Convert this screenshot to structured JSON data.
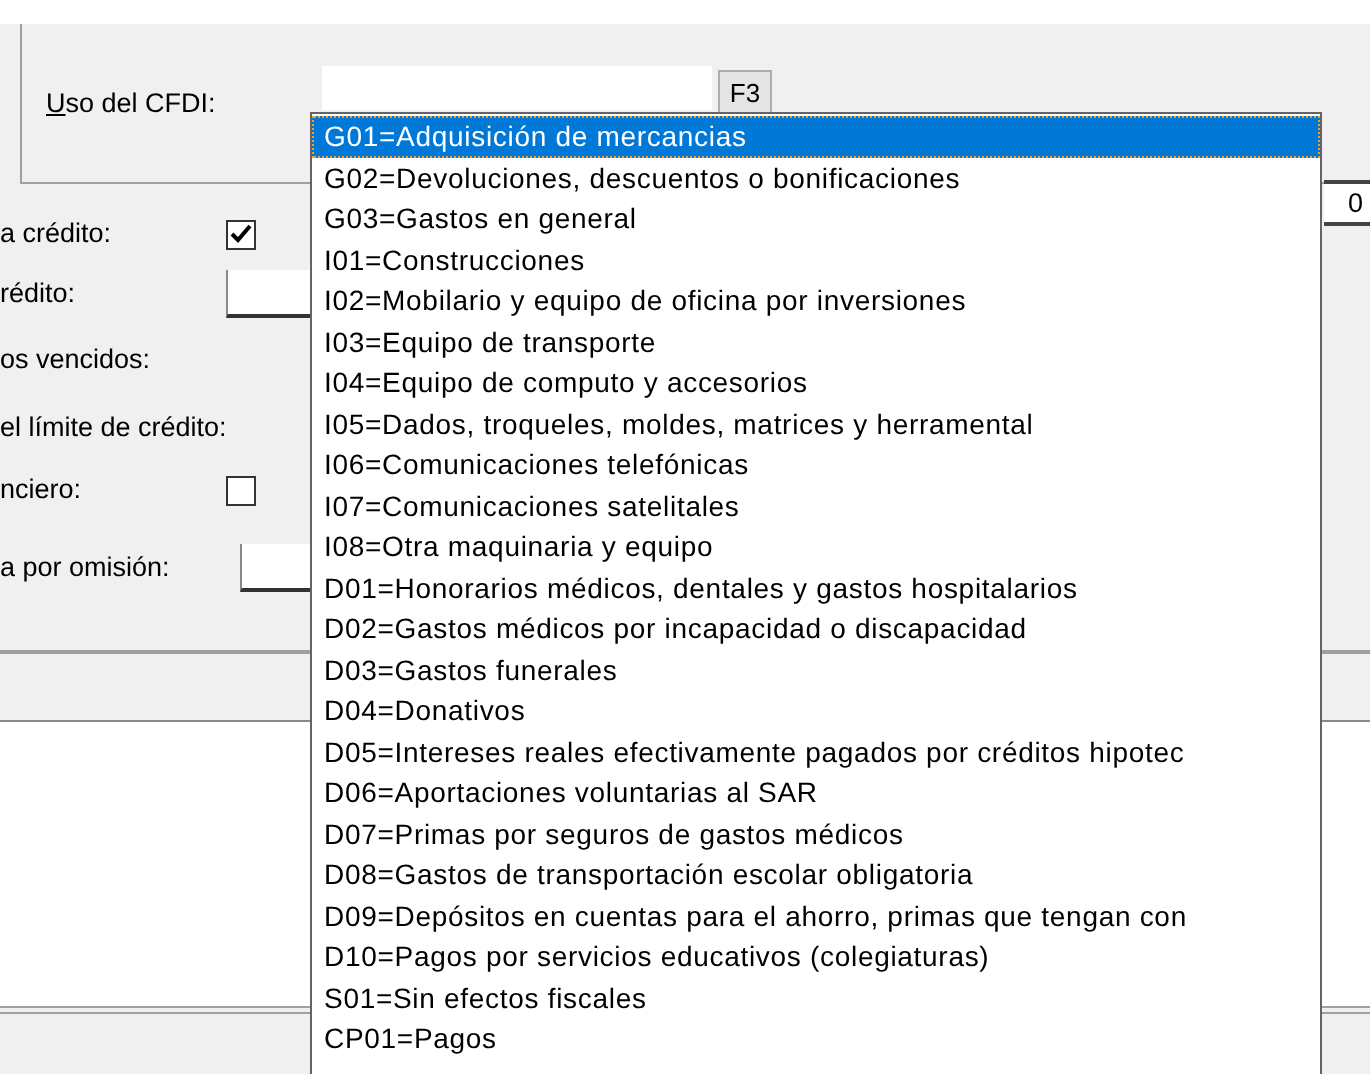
{
  "uso_cfdi": {
    "label": "Uso del CFDI:",
    "button": "F3"
  },
  "form_rows": [
    {
      "kind": "checkbox",
      "label": "a crédito:",
      "checked": true
    },
    {
      "kind": "field",
      "label": "rédito:"
    },
    {
      "kind": "text",
      "label": "os vencidos:"
    },
    {
      "kind": "text",
      "label": "el límite de crédito:"
    },
    {
      "kind": "checkbox",
      "label": "nciero:",
      "checked": false
    },
    {
      "kind": "field",
      "label": "a por omisión:"
    }
  ],
  "right_field": {
    "value": "0"
  },
  "dropdown": {
    "items": [
      {
        "label": "G01=Adquisición de mercancias",
        "selected": true
      },
      {
        "label": "G02=Devoluciones, descuentos o bonificaciones",
        "selected": false
      },
      {
        "label": "G03=Gastos en general",
        "selected": false
      },
      {
        "label": "I01=Construcciones",
        "selected": false
      },
      {
        "label": "I02=Mobilario y equipo de oficina por inversiones",
        "selected": false
      },
      {
        "label": "I03=Equipo de transporte",
        "selected": false
      },
      {
        "label": "I04=Equipo de computo y accesorios",
        "selected": false
      },
      {
        "label": "I05=Dados, troqueles, moldes, matrices y herramental",
        "selected": false
      },
      {
        "label": "I06=Comunicaciones telefónicas",
        "selected": false
      },
      {
        "label": "I07=Comunicaciones satelitales",
        "selected": false
      },
      {
        "label": "I08=Otra maquinaria y equipo",
        "selected": false
      },
      {
        "label": "D01=Honorarios médicos, dentales y gastos hospitalarios",
        "selected": false
      },
      {
        "label": "D02=Gastos médicos por incapacidad o discapacidad",
        "selected": false
      },
      {
        "label": "D03=Gastos funerales",
        "selected": false
      },
      {
        "label": "D04=Donativos",
        "selected": false
      },
      {
        "label": "D05=Intereses reales efectivamente pagados por créditos hipotec",
        "selected": false
      },
      {
        "label": "D06=Aportaciones voluntarias al SAR",
        "selected": false
      },
      {
        "label": "D07=Primas por seguros de gastos médicos",
        "selected": false
      },
      {
        "label": "D08=Gastos de transportación escolar obligatoria",
        "selected": false
      },
      {
        "label": "D09=Depósitos en cuentas para el ahorro, primas que tengan con",
        "selected": false
      },
      {
        "label": "D10=Pagos por servicios educativos (colegiaturas)",
        "selected": false
      },
      {
        "label": "S01=Sin efectos fiscales",
        "selected": false
      },
      {
        "label": "CP01=Pagos",
        "selected": false
      }
    ]
  }
}
